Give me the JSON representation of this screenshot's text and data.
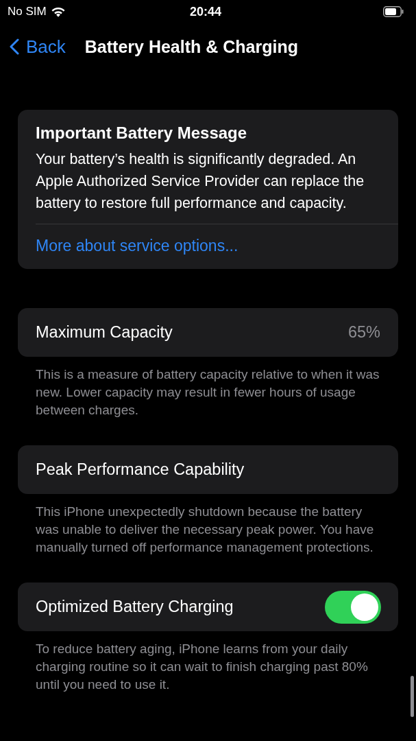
{
  "status_bar": {
    "carrier": "No SIM",
    "time": "20:44"
  },
  "nav": {
    "back": "Back",
    "title": "Battery Health & Charging"
  },
  "message": {
    "title": "Important Battery Message",
    "body": "Your battery’s health is significantly degraded. An Apple Authorized Service Provider can replace the battery to restore full performance and capacity.",
    "link": "More about service options..."
  },
  "sections": [
    {
      "kind": "value",
      "label": "Maximum Capacity",
      "value": "65%",
      "footer": "This is a measure of battery capacity relative to when it was new. Lower capacity may result in fewer hours of usage between charges."
    },
    {
      "kind": "plain",
      "label": "Peak Performance Capability",
      "footer": "This iPhone unexpectedly shutdown because the battery was unable to deliver the necessary peak power. You have manually turned off performance management protections."
    },
    {
      "kind": "toggle",
      "label": "Optimized Battery Charging",
      "on": true,
      "footer": "To reduce battery aging, iPhone learns from your daily charging routine so it can wait to finish charging past 80% until you need to use it."
    }
  ]
}
